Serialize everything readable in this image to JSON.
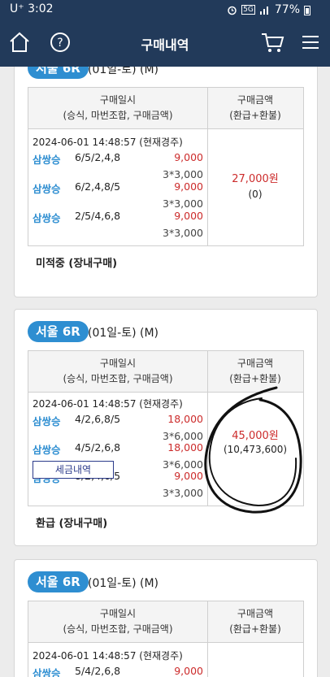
{
  "status_bar": {
    "carrier": "U⁺ 3:02",
    "network": "5G",
    "battery": "77%"
  },
  "header": {
    "title": "구매내역",
    "icons": [
      "home-icon",
      "help-icon",
      "cart-icon",
      "menu-icon"
    ]
  },
  "table_headers": {
    "left_line1": "구매일시",
    "left_line2": "(승식, 마번조합, 구매금액)",
    "right_line1": "구매금액",
    "right_line2": "(환급+환불)"
  },
  "cards": [
    {
      "race": "서울 6R",
      "date": "(01일-토) (M)",
      "datetime": "2024-06-01 14:48:57 (현재경주)",
      "bets": [
        {
          "type": "삼쌍승",
          "combo": "6/5/2,4,8",
          "amount": "9,000",
          "detail": "3*3,000"
        },
        {
          "type": "삼쌍승",
          "combo": "6/2,4,8/5",
          "amount": "9,000",
          "detail": "3*3,000"
        },
        {
          "type": "삼쌍승",
          "combo": "2/5/4,6,8",
          "amount": "9,000",
          "detail": "3*3,000"
        }
      ],
      "total": "27,000원",
      "refund": "(0)",
      "status": "미적중 (장내구매)"
    },
    {
      "race": "서울 6R",
      "date": "(01일-토) (M)",
      "datetime": "2024-06-01 14:48:57 (현재경주)",
      "bets": [
        {
          "type": "삼쌍승",
          "combo": "4/2,6,8/5",
          "amount": "18,000",
          "detail": "3*6,000"
        },
        {
          "type": "삼쌍승",
          "combo": "4/5/2,6,8",
          "amount": "18,000",
          "detail": "3*6,000"
        },
        {
          "type": "삼쌍승",
          "combo": "8/2,4,6/5",
          "amount": "9,000",
          "detail": "3*3,000"
        }
      ],
      "total": "45,000원",
      "refund": "(10,473,600)",
      "tax_button": "세금내역",
      "status": "환급 (장내구매)"
    },
    {
      "race": "서울 6R",
      "date": "(01일-토) (M)",
      "datetime": "2024-06-01 14:48:57 (현재경주)",
      "bets": [
        {
          "type": "삼쌍승",
          "combo": "5/4/2,6,8",
          "amount": "9,000",
          "detail": ""
        }
      ]
    }
  ]
}
